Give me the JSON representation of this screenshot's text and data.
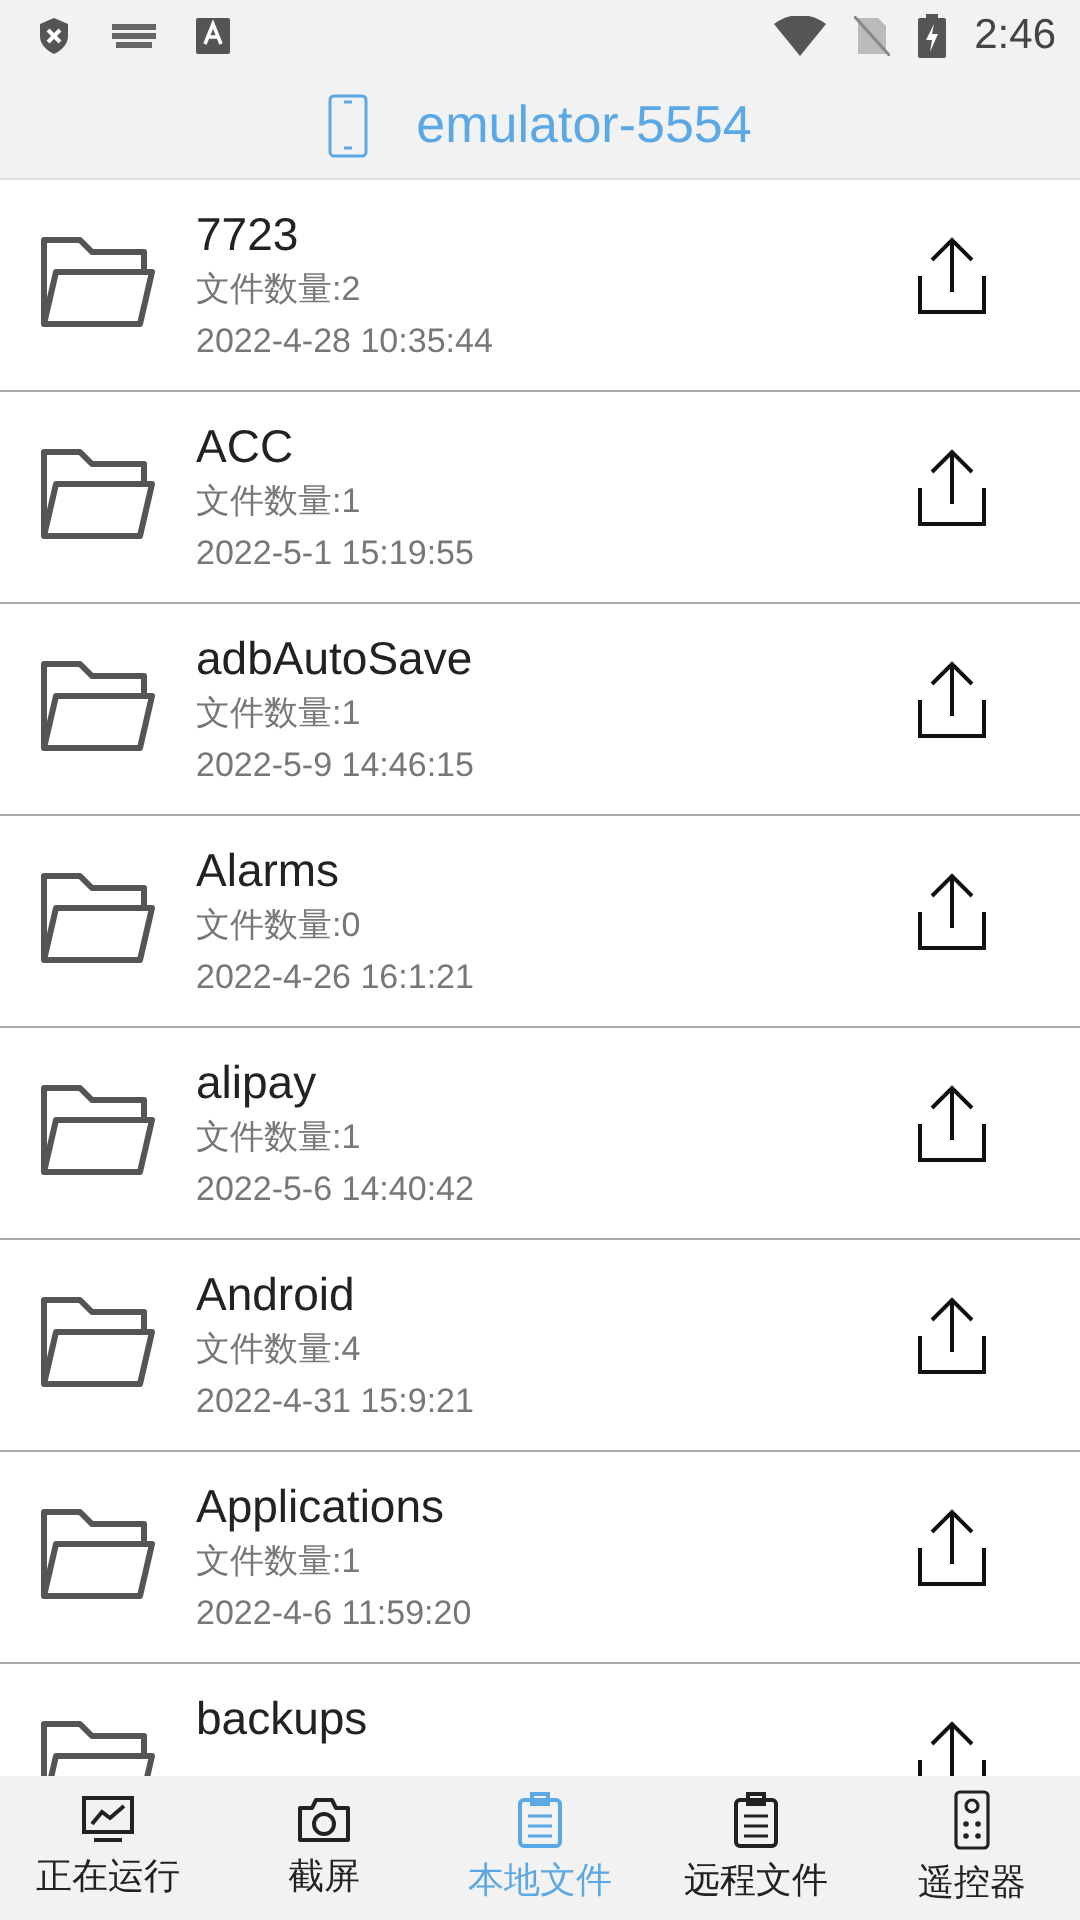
{
  "status_bar": {
    "time": "2:46"
  },
  "header": {
    "title": "emulator-5554"
  },
  "files": [
    {
      "name": "7723",
      "count": "文件数量:2",
      "date": "2022-4-28 10:35:44"
    },
    {
      "name": "ACC",
      "count": "文件数量:1",
      "date": "2022-5-1 15:19:55"
    },
    {
      "name": "adbAutoSave",
      "count": "文件数量:1",
      "date": "2022-5-9 14:46:15"
    },
    {
      "name": "Alarms",
      "count": "文件数量:0",
      "date": "2022-4-26 16:1:21"
    },
    {
      "name": "alipay",
      "count": "文件数量:1",
      "date": "2022-5-6 14:40:42"
    },
    {
      "name": "Android",
      "count": "文件数量:4",
      "date": "2022-4-31 15:9:21"
    },
    {
      "name": "Applications",
      "count": "文件数量:1",
      "date": "2022-4-6 11:59:20"
    },
    {
      "name": "backups"
    }
  ],
  "bottom_nav": [
    {
      "label": "正在运行",
      "kind": "chart",
      "selected": false
    },
    {
      "label": "截屏",
      "kind": "camera",
      "selected": false
    },
    {
      "label": "本地文件",
      "kind": "clipboard",
      "selected": true
    },
    {
      "label": "远程文件",
      "kind": "clipboard",
      "selected": false
    },
    {
      "label": "遥控器",
      "kind": "remote",
      "selected": false
    }
  ]
}
